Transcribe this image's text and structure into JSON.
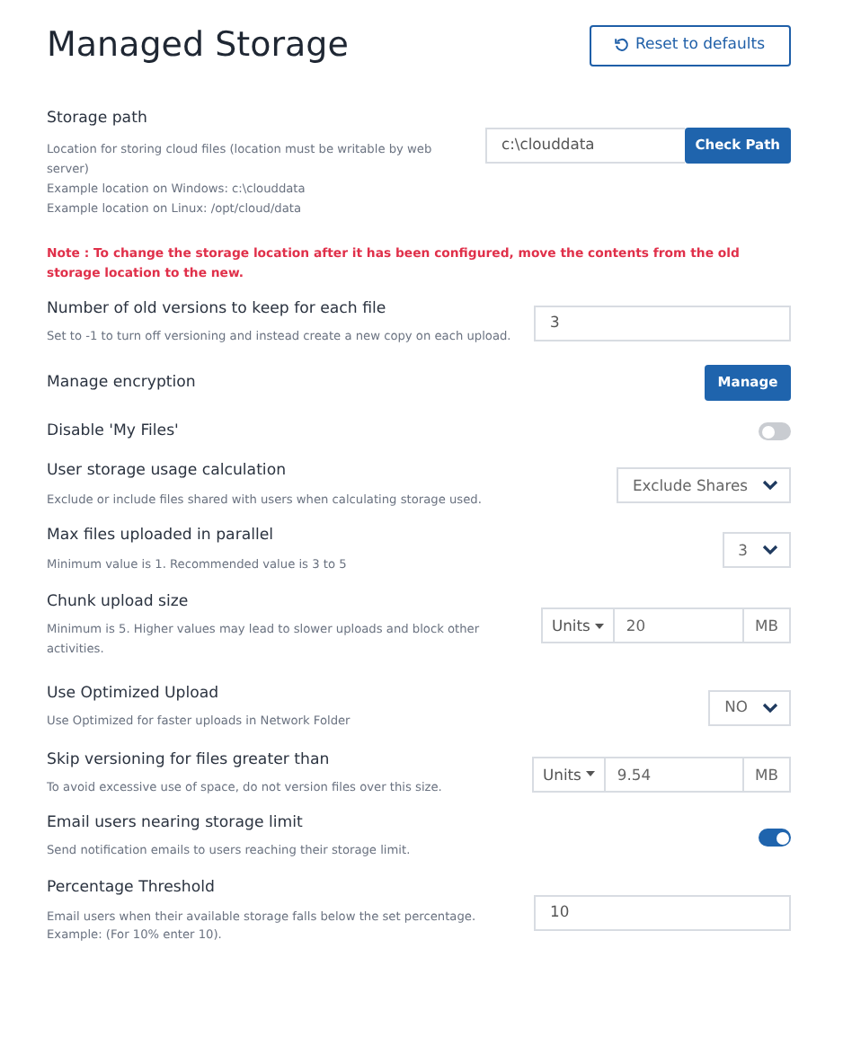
{
  "title": "Managed Storage",
  "reset_button": "Reset to defaults",
  "settings": [
    {
      "kind": "path",
      "label": "Storage path",
      "description": [
        "Location for storing cloud files (location must be writable by web server)",
        "Example location on Windows: c:\\clouddata",
        "Example location on Linux: /opt/cloud/data"
      ],
      "value": "c:\\clouddata",
      "button": "Check Path",
      "note": "Note : To change the storage location after it has been configured, move the contents from the old storage location to the new."
    },
    {
      "kind": "input",
      "label": "Number of old versions to keep for each file",
      "description": [
        "Set to -1 to turn off versioning and instead create a new copy on each upload."
      ],
      "value": "3"
    },
    {
      "kind": "button",
      "label": "Manage encryption",
      "button": "Manage"
    },
    {
      "kind": "toggle",
      "label": "Disable 'My Files'",
      "on": false
    },
    {
      "kind": "select",
      "label": "User storage usage calculation",
      "description": [
        "Exclude or include files shared with users when calculating storage used."
      ],
      "value": "Exclude Shares"
    },
    {
      "kind": "select",
      "label": "Max files uploaded in parallel",
      "description": [
        "Minimum value is 1. Recommended value is 3 to 5"
      ],
      "value": "3"
    },
    {
      "kind": "units",
      "label": "Chunk upload size",
      "description": [
        "Minimum is 5. Higher values may lead to slower uploads and block other activities."
      ],
      "units": "Units",
      "value": "20",
      "suffix": "MB"
    },
    {
      "kind": "select",
      "label": "Use Optimized Upload",
      "description": [
        "Use Optimized for faster uploads in Network Folder"
      ],
      "value": "NO"
    },
    {
      "kind": "units",
      "label": "Skip versioning for files greater than",
      "description": [
        "To avoid excessive use of space, do not version files over this size."
      ],
      "units": "Units",
      "value": "9.54",
      "suffix": "MB"
    },
    {
      "kind": "toggle",
      "label": "Email users nearing storage limit",
      "description": [
        "Send notification emails to users reaching their storage limit."
      ],
      "on": true
    },
    {
      "kind": "input",
      "label": "Percentage Threshold",
      "description": [
        "Email users when their available storage falls below the set percentage.",
        "Example: (For 10% enter 10)."
      ],
      "value": "10"
    }
  ]
}
